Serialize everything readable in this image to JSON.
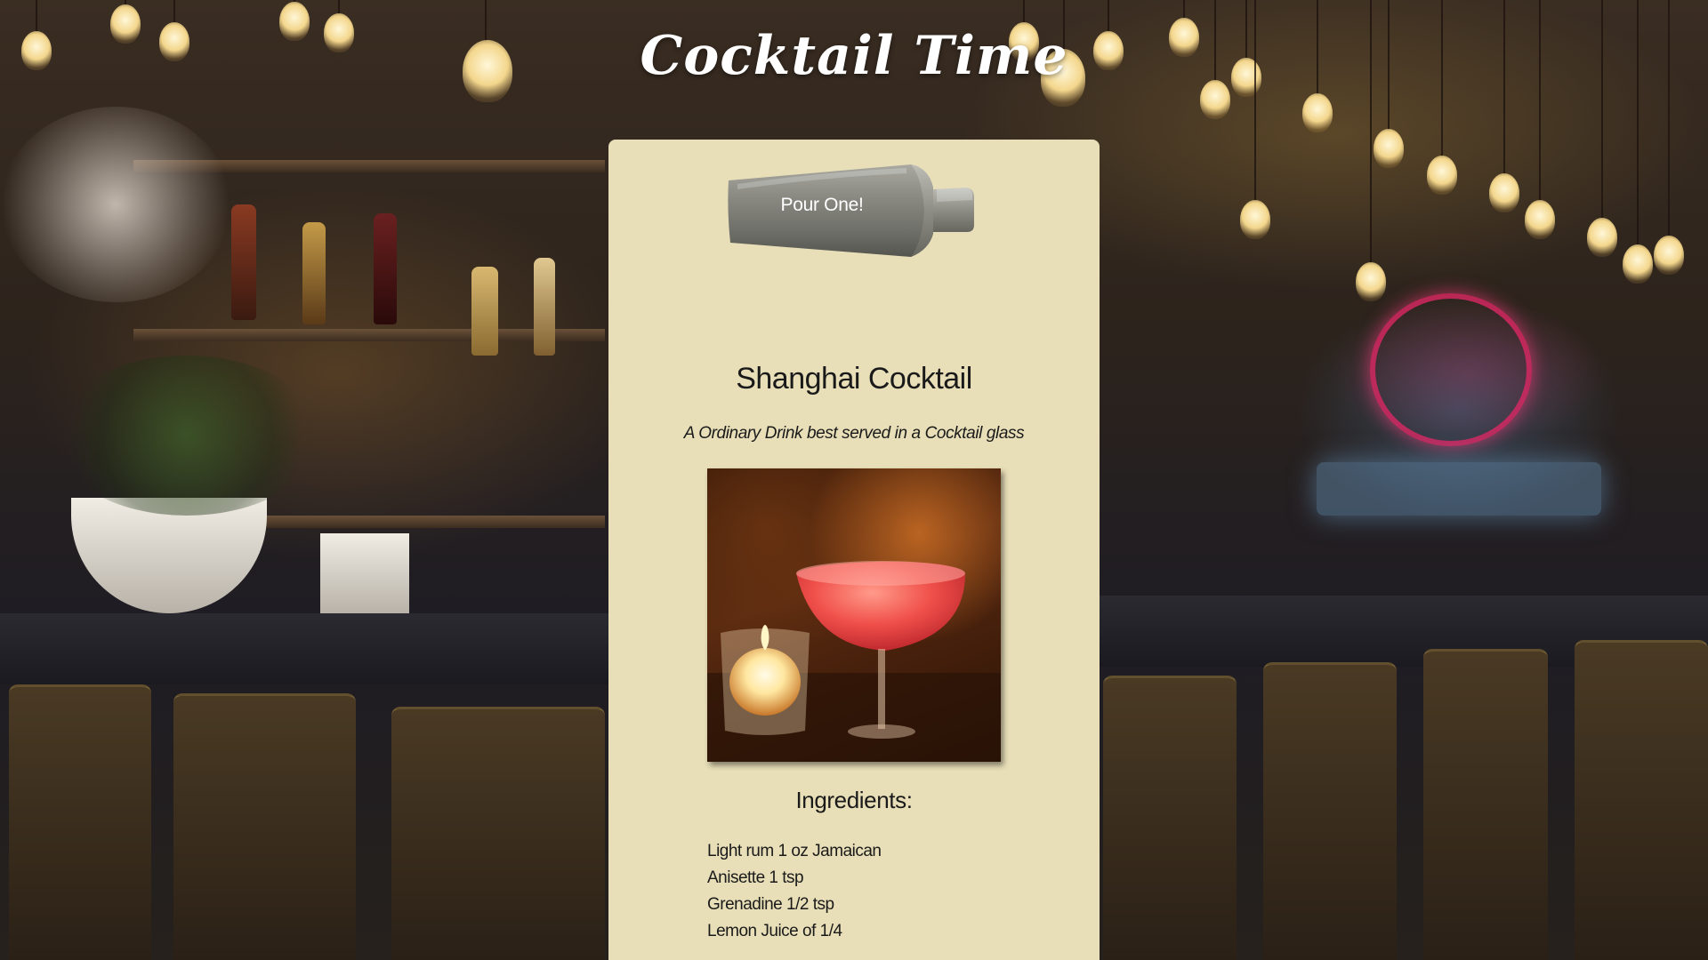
{
  "header": {
    "title": "Cocktail Time"
  },
  "shaker_button": {
    "label": "Pour One!"
  },
  "drink": {
    "name": "Shanghai Cocktail",
    "description": "A Ordinary Drink best served in a Cocktail glass",
    "ingredients_heading": "Ingredients:",
    "ingredients": [
      "Light rum 1 oz Jamaican",
      "Anisette 1 tsp",
      "Grenadine 1/2 tsp",
      "Lemon Juice of 1/4"
    ]
  },
  "colors": {
    "card_background": "#e8dfb8",
    "shaker_metal": "#7a7a74",
    "title_text": "#ffffff"
  }
}
